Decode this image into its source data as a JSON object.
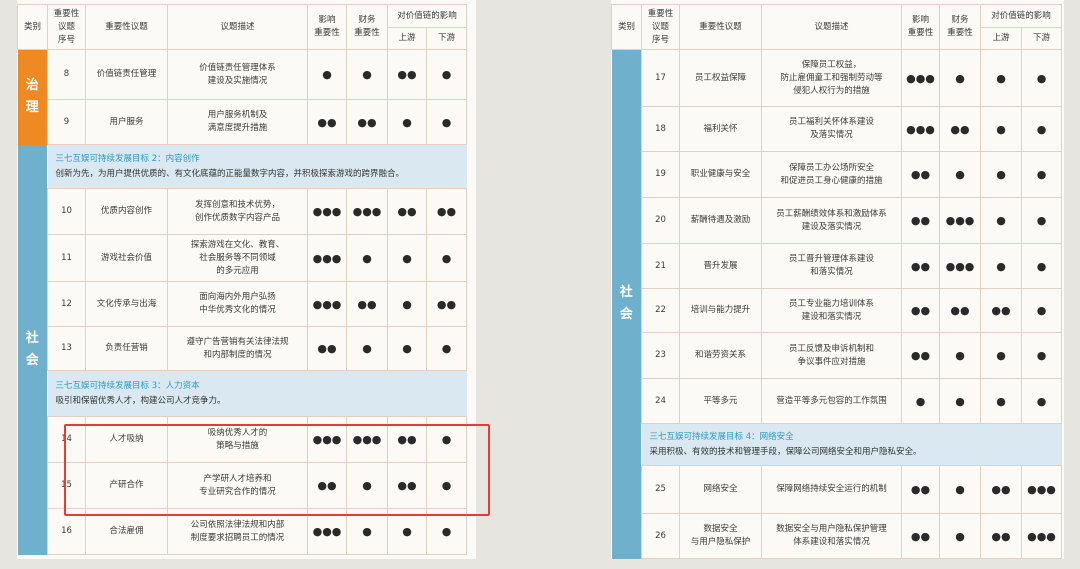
{
  "headers": {
    "category": "类别",
    "seq": [
      "重要性",
      "议题",
      "序号"
    ],
    "topic": "重要性议题",
    "desc": "议题描述",
    "impact": [
      "影响",
      "重要性"
    ],
    "financial": [
      "财务",
      "重要性"
    ],
    "valuechain": "对价值链的影响",
    "upstream": "上游",
    "downstream": "下游"
  },
  "categories": {
    "governance": [
      "治",
      "理"
    ],
    "social": [
      "社",
      "会"
    ]
  },
  "left": {
    "gov_rows": [
      {
        "no": "8",
        "topic": [
          "价值链责任管理"
        ],
        "desc": [
          "价值链责任管理体系",
          "建设及实施情况"
        ],
        "impact": "●",
        "fin": "●",
        "up": "●●",
        "down": "●"
      },
      {
        "no": "9",
        "topic": [
          "用户服务"
        ],
        "desc": [
          "用户服务机制及",
          "满意度提升措施"
        ],
        "impact": "●●",
        "fin": "●●",
        "up": "●",
        "down": "●"
      }
    ],
    "goal2": {
      "title": "三七互娱可持续发展目标 2：内容创作",
      "desc": "创新为先，为用户提供优质的、有文化底蕴的正能量数字内容，并积极探索游戏的跨界融合。"
    },
    "goal2_rows": [
      {
        "no": "10",
        "topic": [
          "优质内容创作"
        ],
        "desc": [
          "发挥创意和技术优势，",
          "创作优质数字内容产品"
        ],
        "impact": "●●●",
        "fin": "●●●",
        "up": "●●",
        "down": "●●"
      },
      {
        "no": "11",
        "topic": [
          "游戏社会价值"
        ],
        "desc": [
          "探索游戏在文化、教育、",
          "社会服务等不同领域",
          "的多元应用"
        ],
        "impact": "●●●",
        "fin": "●",
        "up": "●",
        "down": "●"
      },
      {
        "no": "12",
        "topic": [
          "文化传承与出海"
        ],
        "desc": [
          "面向海内外用户弘扬",
          "中华优秀文化的情况"
        ],
        "impact": "●●●",
        "fin": "●●",
        "up": "●",
        "down": "●●"
      },
      {
        "no": "13",
        "topic": [
          "负责任营销"
        ],
        "desc": [
          "遵守广告营销有关法律法规",
          "和内部制度的情况"
        ],
        "impact": "●●",
        "fin": "●",
        "up": "●",
        "down": "●"
      }
    ],
    "goal3": {
      "title": "三七互娱可持续发展目标 3：人力资本",
      "desc": "吸引和保留优秀人才，构建公司人才竞争力。"
    },
    "goal3_rows": [
      {
        "no": "14",
        "topic": [
          "人才吸纳"
        ],
        "desc": [
          "吸纳优秀人才的",
          "策略与措施"
        ],
        "impact": "●●●",
        "fin": "●●●",
        "up": "●●",
        "down": "●"
      },
      {
        "no": "15",
        "topic": [
          "产研合作"
        ],
        "desc": [
          "产学研人才培养和",
          "专业研究合作的情况"
        ],
        "impact": "●●",
        "fin": "●",
        "up": "●●",
        "down": "●"
      },
      {
        "no": "16",
        "topic": [
          "合法雇佣"
        ],
        "desc": [
          "公司依照法律法规和内部",
          "制度要求招聘员工的情况"
        ],
        "impact": "●●●",
        "fin": "●",
        "up": "●",
        "down": "●"
      }
    ]
  },
  "right": {
    "rows": [
      {
        "no": "17",
        "topic": [
          "员工权益保障"
        ],
        "desc": [
          "保障员工权益，",
          "防止雇佣童工和强制劳动等",
          "侵犯人权行为的措施"
        ],
        "impact": "●●●",
        "fin": "●",
        "up": "●",
        "down": "●"
      },
      {
        "no": "18",
        "topic": [
          "福利关怀"
        ],
        "desc": [
          "员工福利关怀体系建设",
          "及落实情况"
        ],
        "impact": "●●●",
        "fin": "●●",
        "up": "●",
        "down": "●"
      },
      {
        "no": "19",
        "topic": [
          "职业健康与安全"
        ],
        "desc": [
          "保障员工办公场所安全",
          "和促进员工身心健康的措施"
        ],
        "impact": "●●",
        "fin": "●",
        "up": "●",
        "down": "●"
      },
      {
        "no": "20",
        "topic": [
          "薪酬待遇及激励"
        ],
        "desc": [
          "员工薪酬绩效体系和激励体系",
          "建设及落实情况"
        ],
        "impact": "●●",
        "fin": "●●●",
        "up": "●",
        "down": "●"
      },
      {
        "no": "21",
        "topic": [
          "晋升发展"
        ],
        "desc": [
          "员工晋升管理体系建设",
          "和落实情况"
        ],
        "impact": "●●",
        "fin": "●●●",
        "up": "●",
        "down": "●"
      },
      {
        "no": "22",
        "topic": [
          "培训与能力提升"
        ],
        "desc": [
          "员工专业能力培训体系",
          "建设和落实情况"
        ],
        "impact": "●●",
        "fin": "●●",
        "up": "●●",
        "down": "●"
      },
      {
        "no": "23",
        "topic": [
          "和谐劳资关系"
        ],
        "desc": [
          "员工反馈及申诉机制和",
          "争议事件应对措施"
        ],
        "impact": "●●",
        "fin": "●",
        "up": "●",
        "down": "●"
      },
      {
        "no": "24",
        "topic": [
          "平等多元"
        ],
        "desc": [
          "营造平等多元包容的工作氛围"
        ],
        "impact": "●",
        "fin": "●",
        "up": "●",
        "down": "●"
      }
    ],
    "goal4": {
      "title": "三七互娱可持续发展目标 4：网络安全",
      "desc": "采用积极、有效的技术和管理手段，保障公司网络安全和用户隐私安全。"
    },
    "goal4_rows": [
      {
        "no": "25",
        "topic": [
          "网络安全"
        ],
        "desc": [
          "保障网络持续安全运行的机制"
        ],
        "impact": "●●",
        "fin": "●",
        "up": "●●",
        "down": "●●●"
      },
      {
        "no": "26",
        "topic": [
          "数据安全",
          "与用户隐私保护"
        ],
        "desc": [
          "数据安全与用户隐私保护管理",
          "体系建设和落实情况"
        ],
        "impact": "●●",
        "fin": "●",
        "up": "●●",
        "down": "●●●"
      }
    ]
  }
}
